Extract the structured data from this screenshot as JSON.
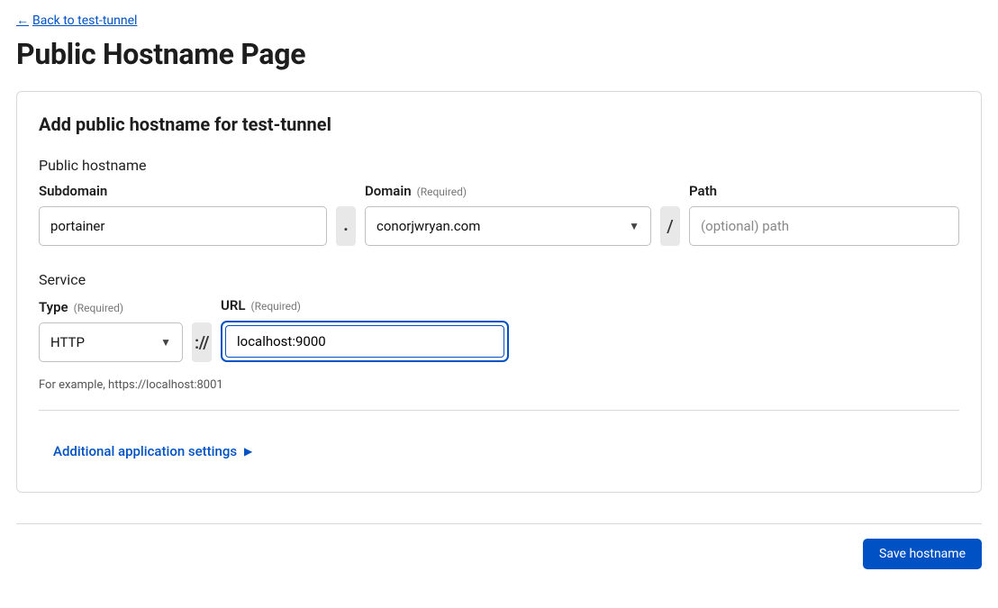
{
  "back_link_text": "Back to test-tunnel",
  "page_title": "Public Hostname Page",
  "card_title": "Add public hostname for test-tunnel",
  "required_text": "(Required)",
  "public_hostname": {
    "section_label": "Public hostname",
    "subdomain_label": "Subdomain",
    "subdomain_value": "portainer",
    "domain_label": "Domain",
    "domain_value": "conorjwryan.com",
    "path_label": "Path",
    "path_placeholder": "(optional) path",
    "separator_dot": ".",
    "separator_slash": "/"
  },
  "service": {
    "section_label": "Service",
    "type_label": "Type",
    "type_value": "HTTP",
    "url_label": "URL",
    "url_value": "localhost:9000",
    "scheme_separator": "://",
    "example_text": "For example, https://localhost:8001"
  },
  "additional_settings_label": "Additional application settings",
  "save_button_label": "Save hostname"
}
